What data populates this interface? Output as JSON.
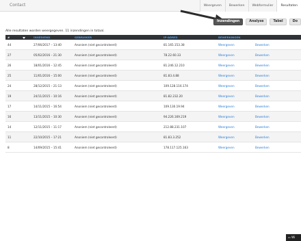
{
  "header": {
    "title": "Contact",
    "tabs": [
      "Weergeven",
      "Bewerken",
      "Webformulier",
      "Resultaten"
    ]
  },
  "subbar": {
    "buttons": [
      "Inzendingen",
      "Analyse",
      "Tabel",
      "Do"
    ]
  },
  "summary": "Alle resultaten worden weergegeven. 11 inzendingen in totaal.",
  "table": {
    "headers": [
      "#",
      "INGEDIEND",
      "GEBRUIKER",
      "IP-ADRES",
      "BEWERKINGEN"
    ],
    "rows": [
      {
        "num": "44",
        "date": "27/06/2017 – 13:40",
        "user": "Anoniem (niet gecontroleerd)",
        "ip": "81.165.153.38",
        "view": "Weergeven",
        "edit": "Bewerken"
      },
      {
        "num": "27",
        "date": "05/02/2016 – 21:30",
        "user": "Anoniem (niet gecontroleerd)",
        "ip": "78.22.60.33",
        "view": "Weergeven",
        "edit": "Bewerken"
      },
      {
        "num": "26",
        "date": "18/01/2016 – 12:45",
        "user": "Anoniem (niet gecontroleerd)",
        "ip": "81.246.12.210",
        "view": "Weergeven",
        "edit": "Bewerken"
      },
      {
        "num": "25",
        "date": "11/01/2016 – 15:00",
        "user": "Anoniem (niet gecontroleerd)",
        "ip": "81.83.4.88",
        "view": "Weergeven",
        "edit": "Bewerken"
      },
      {
        "num": "24",
        "date": "28/12/2015 – 21:13",
        "user": "Anoniem (niet gecontroleerd)",
        "ip": "109.128.116.174",
        "view": "Weergeven",
        "edit": "Bewerken"
      },
      {
        "num": "19",
        "date": "24/11/2015 – 10:16",
        "user": "Anoniem (niet gecontroleerd)",
        "ip": "81.82.232.20",
        "view": "Weergeven",
        "edit": "Bewerken"
      },
      {
        "num": "17",
        "date": "14/11/2015 – 16:54",
        "user": "Anoniem (niet gecontroleerd)",
        "ip": "109.130.19.94",
        "view": "Weergeven",
        "edit": "Bewerken"
      },
      {
        "num": "16",
        "date": "13/11/2015 – 10:30",
        "user": "Anoniem (niet gecontroleerd)",
        "ip": "94.226.169.219",
        "view": "Weergeven",
        "edit": "Bewerken"
      },
      {
        "num": "14",
        "date": "12/11/2015 – 11:17",
        "user": "Anoniem (niet gecontroleerd)",
        "ip": "212.88.231.107",
        "view": "Weergeven",
        "edit": "Bewerken"
      },
      {
        "num": "11",
        "date": "22/10/2015 – 17:21",
        "user": "Anoniem (niet gecontroleerd)",
        "ip": "81.83.3.252",
        "view": "Weergeven",
        "edit": "Bewerken"
      },
      {
        "num": "8",
        "date": "14/09/2015 – 15:41",
        "user": "Anoniem (niet gecontroleerd)",
        "ip": "178.117.125.163",
        "view": "Weergeven",
        "edit": "Bewerken"
      }
    ]
  },
  "chat_label": "Wi",
  "colors": {
    "header_bg": "#2f3337",
    "link": "#2a7ed6",
    "primary_button": "#555555"
  }
}
